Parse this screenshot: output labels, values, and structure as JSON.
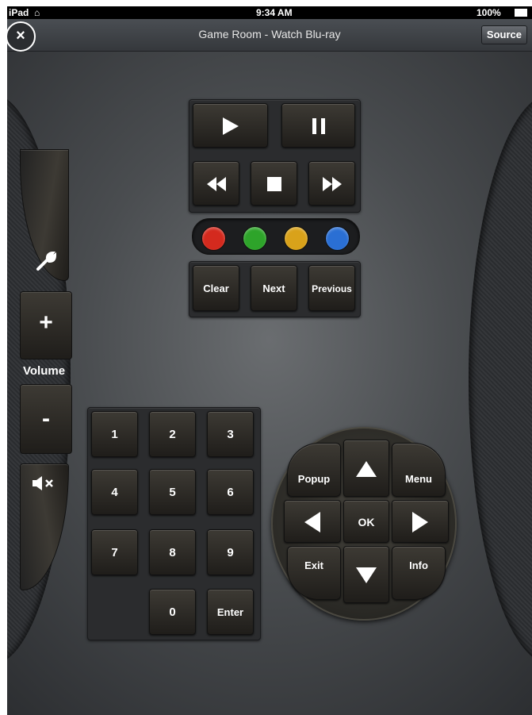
{
  "status_bar": {
    "device": "iPad",
    "time": "9:34 AM",
    "battery": "100%"
  },
  "header": {
    "title": "Game Room - Watch Blu-ray",
    "close_label": "×",
    "source_label": "Source"
  },
  "transport": {
    "play_icon": "play-icon",
    "pause_icon": "pause-icon",
    "rewind_icon": "rewind-icon",
    "stop_icon": "stop-icon",
    "fast_forward_icon": "fast-forward-icon"
  },
  "color_buttons": {
    "red": "#d42a1e",
    "green": "#2ea42a",
    "yellow": "#d9a21a",
    "blue": "#2a6fd4"
  },
  "functions": {
    "clear": "Clear",
    "next": "Next",
    "previous": "Previous"
  },
  "volume": {
    "label": "Volume",
    "up": "+",
    "down": "-",
    "settings_icon": "wrench-icon",
    "mute_icon": "mute-icon"
  },
  "keypad": {
    "keys": [
      "1",
      "2",
      "3",
      "4",
      "5",
      "6",
      "7",
      "8",
      "9"
    ],
    "zero": "0",
    "enter": "Enter"
  },
  "dpad": {
    "popup": "Popup",
    "menu": "Menu",
    "ok": "OK",
    "exit": "Exit",
    "info": "Info"
  }
}
